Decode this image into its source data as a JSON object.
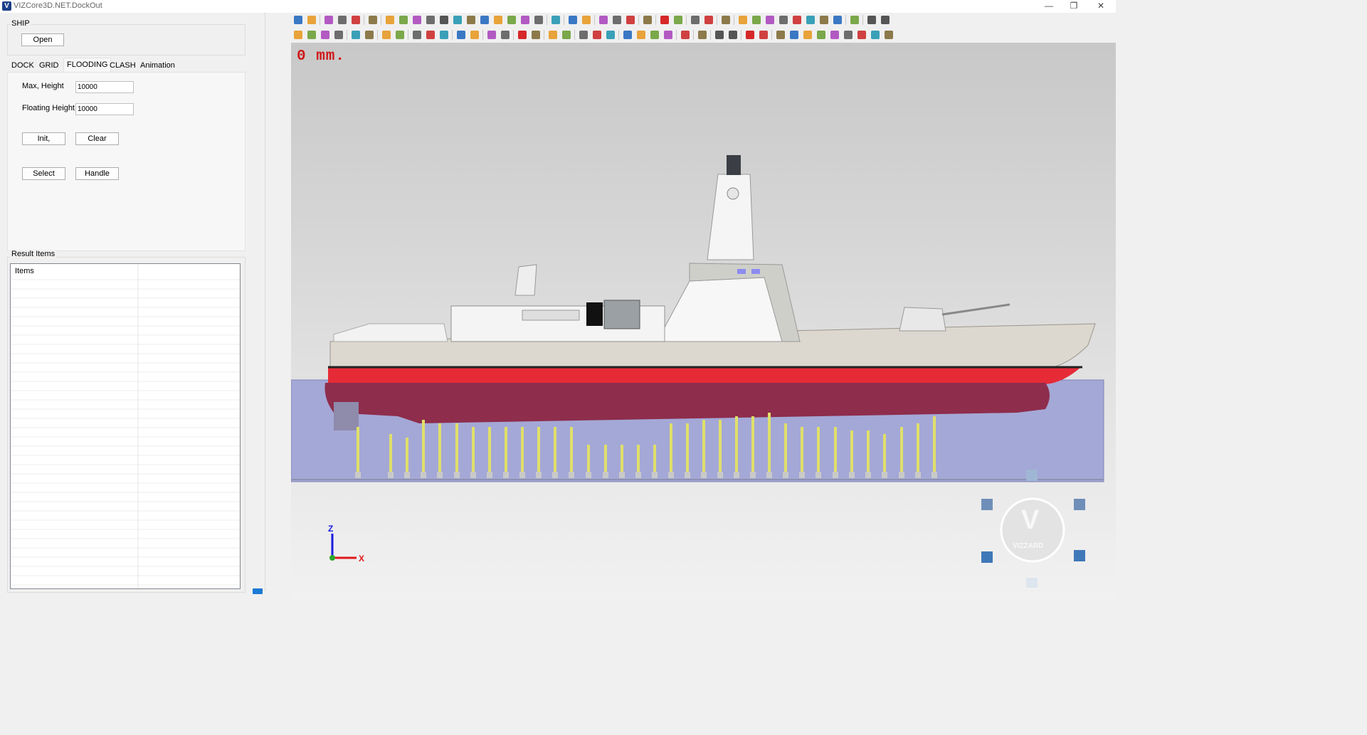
{
  "window": {
    "title": "VIZCore3D.NET.DockOut",
    "logo_letter": "V",
    "controls": [
      "—",
      "❐",
      "✕"
    ]
  },
  "ship_group": {
    "label": "SHIP",
    "open_button": "Open"
  },
  "tabs": [
    {
      "label": "DOCK",
      "active": false
    },
    {
      "label": "GRID",
      "active": false
    },
    {
      "label": "FLOODING",
      "active": true
    },
    {
      "label": "CLASH",
      "active": false
    },
    {
      "label": "Animation",
      "active": false
    }
  ],
  "flooding": {
    "max_height_label": "Max, Height",
    "max_height_value": "10000",
    "floating_height_label": "Floating Height",
    "floating_height_value": "10000",
    "init_button": "Init,",
    "clear_button": "Clear",
    "select_button": "Select",
    "handle_button": "Handle"
  },
  "results": {
    "label": "Result Items",
    "columns": [
      "Items",
      ""
    ],
    "rows": []
  },
  "viewport": {
    "depth_readout": "0 mm.",
    "axis_z": "Z",
    "axis_x": "X",
    "logo_letter": "V",
    "logo_text": "VIZZARD",
    "colors": {
      "hull_red": "#e62b37",
      "water": "#a4a8d6",
      "pillar": "#e0df6a",
      "readout": "#d01818"
    }
  },
  "toolbar_rows": [
    {
      "icons": [
        "new-file",
        "new-document",
        "separator",
        "open-folder",
        "open-dropdown",
        "save",
        "separator",
        "tree",
        "separator",
        "select-box",
        "move-tool",
        "color-fill",
        "check-tool",
        "view-eye",
        "rotate-tool",
        "color-wheel",
        "sphere-tool",
        "binocular",
        "image",
        "print",
        "measure",
        "separator",
        "layout",
        "separator",
        "settings",
        "info",
        "separator",
        "copy",
        "paste",
        "group",
        "separator",
        "visibility",
        "separator",
        "delete-red",
        "trash",
        "separator",
        "note",
        "edit",
        "separator",
        "star-tool",
        "separator",
        "text",
        "pen",
        "line",
        "arrow",
        "arc",
        "rectangle",
        "circle",
        "polygon",
        "separator",
        "eraser",
        "separator",
        "eye",
        "eye-hide"
      ]
    },
    {
      "icons": [
        "box-view",
        "box-3d",
        "cube",
        "cube-wire",
        "separator",
        "render",
        "render2",
        "separator",
        "tools",
        "tools2",
        "separator",
        "solid",
        "transparent",
        "hidden",
        "separator",
        "section",
        "section2",
        "separator",
        "line-tool",
        "rect-tool",
        "separator",
        "delete-red",
        "trash",
        "separator",
        "copy",
        "paint",
        "separator",
        "line-draw",
        "edge",
        "curve",
        "separator",
        "angle",
        "cube-black",
        "cube-color",
        "chart",
        "separator",
        "cube-outline",
        "separator",
        "undo",
        "separator",
        "eye",
        "eye-hide",
        "separator",
        "delete-red",
        "trash",
        "separator",
        "hex",
        "cone",
        "cylinder",
        "plane",
        "pyramid",
        "ring",
        "torus",
        "sphere",
        "ellipse"
      ]
    }
  ]
}
